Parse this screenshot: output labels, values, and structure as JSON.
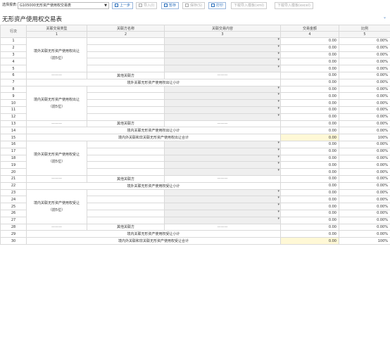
{
  "toolbar": {
    "label": "选择报表:",
    "select_value": "G105000无形资产使用权交易表",
    "buttons": [
      "上一步",
      "导入(I)",
      "暂存",
      "保存(S)",
      "打印",
      "下载导入模板(xml)",
      "下载导入模板(excel)"
    ]
  },
  "title": "无形资产使用权交易表",
  "headers": {
    "row1": [
      "行次",
      "关联交易类型",
      "关联方名称",
      "关联交易内容",
      "交易金额",
      "比例"
    ],
    "row2": [
      "1",
      "2",
      "3",
      "4",
      "5"
    ]
  },
  "groups": {
    "g1": {
      "line1": "境外关联无形资产使用权出让",
      "line2": "（前5位）"
    },
    "g2": {
      "line1": "境内关联无形资产使用权出让",
      "line2": "（前5位）"
    },
    "g3": {
      "line1": "境外关联无形资产使用权受让",
      "line2": "（前5位）"
    },
    "g4": {
      "line1": "境内关联无形资产使用权受让",
      "line2": "（前5位）"
    }
  },
  "labels": {
    "dash": "———",
    "other": "其他关联方",
    "sub7": "境外关联无形资产使用权出让小计",
    "sub14": "境内关联无形资产使用权出让小计",
    "total15": "境内外关联和非关联无形资产使用权出让合计",
    "sub22": "境外关联无形资产使用权受让小计",
    "sub29": "境内关联无形资产使用权受让小计",
    "total30": "境内外关联和非关联无形资产使用权受让合计"
  },
  "rows": [
    {
      "n": "1",
      "amt": "0.00",
      "pct": "0.00%"
    },
    {
      "n": "2",
      "amt": "0.00",
      "pct": "0.00%"
    },
    {
      "n": "3",
      "amt": "0.00",
      "pct": "0.00%"
    },
    {
      "n": "4",
      "amt": "0.00",
      "pct": "0.00%"
    },
    {
      "n": "5",
      "amt": "0.00",
      "pct": "0.00%"
    },
    {
      "n": "6",
      "amt": "0.00",
      "pct": "0.00%"
    },
    {
      "n": "7",
      "amt": "0.00",
      "pct": "0.00%"
    },
    {
      "n": "8",
      "amt": "0.00",
      "pct": "0.00%"
    },
    {
      "n": "9",
      "amt": "0.00",
      "pct": "0.00%"
    },
    {
      "n": "10",
      "amt": "0.00",
      "pct": "0.00%"
    },
    {
      "n": "11",
      "amt": "0.00",
      "pct": "0.00%"
    },
    {
      "n": "12",
      "amt": "0.00",
      "pct": "0.00%"
    },
    {
      "n": "13",
      "amt": "0.00",
      "pct": "0.00%"
    },
    {
      "n": "14",
      "amt": "0.00",
      "pct": "0.00%"
    },
    {
      "n": "15",
      "amt": "0.00",
      "pct": "100%"
    },
    {
      "n": "16",
      "amt": "0.00",
      "pct": "0.00%"
    },
    {
      "n": "17",
      "amt": "0.00",
      "pct": "0.00%"
    },
    {
      "n": "18",
      "amt": "0.00",
      "pct": "0.00%"
    },
    {
      "n": "19",
      "amt": "0.00",
      "pct": "0.00%"
    },
    {
      "n": "20",
      "amt": "0.00",
      "pct": "0.00%"
    },
    {
      "n": "21",
      "amt": "0.00",
      "pct": "0.00%"
    },
    {
      "n": "22",
      "amt": "0.00",
      "pct": "0.00%"
    },
    {
      "n": "23",
      "amt": "0.00",
      "pct": "0.00%"
    },
    {
      "n": "24",
      "amt": "0.00",
      "pct": "0.00%"
    },
    {
      "n": "25",
      "amt": "0.00",
      "pct": "0.00%"
    },
    {
      "n": "26",
      "amt": "0.00",
      "pct": "0.00%"
    },
    {
      "n": "27",
      "amt": "0.00",
      "pct": "0.00%"
    },
    {
      "n": "28",
      "amt": "0.00",
      "pct": "0.00%"
    },
    {
      "n": "29",
      "amt": "0.00",
      "pct": "0.00%"
    },
    {
      "n": "30",
      "amt": "0.00",
      "pct": "100%"
    }
  ]
}
